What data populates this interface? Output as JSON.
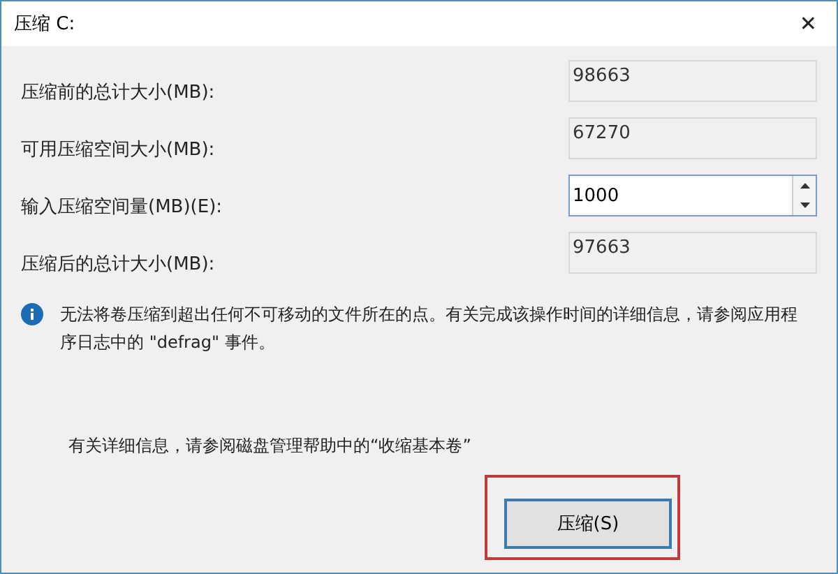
{
  "window": {
    "title": "压缩 C:",
    "close": "✕"
  },
  "fields": [
    {
      "label": "压缩前的总计大小(MB):",
      "value": "98663",
      "kind": "readonly"
    },
    {
      "label": "可用压缩空间大小(MB):",
      "value": "67270",
      "kind": "readonly"
    },
    {
      "label": "输入压缩空间量(MB)(E):",
      "value": "1000",
      "kind": "spin"
    },
    {
      "label": "压缩后的总计大小(MB):",
      "value": "97663",
      "kind": "readonly"
    }
  ],
  "info": "无法将卷压缩到超出任何不可移动的文件所在的点。有关完成该操作时间的详细信息，请参阅应用程序日志中的 \"defrag\" 事件。",
  "help": "有关详细信息，请参阅磁盘管理帮助中的“收缩基本卷”",
  "button": {
    "label": "压缩(S)",
    "highlighted": true
  }
}
